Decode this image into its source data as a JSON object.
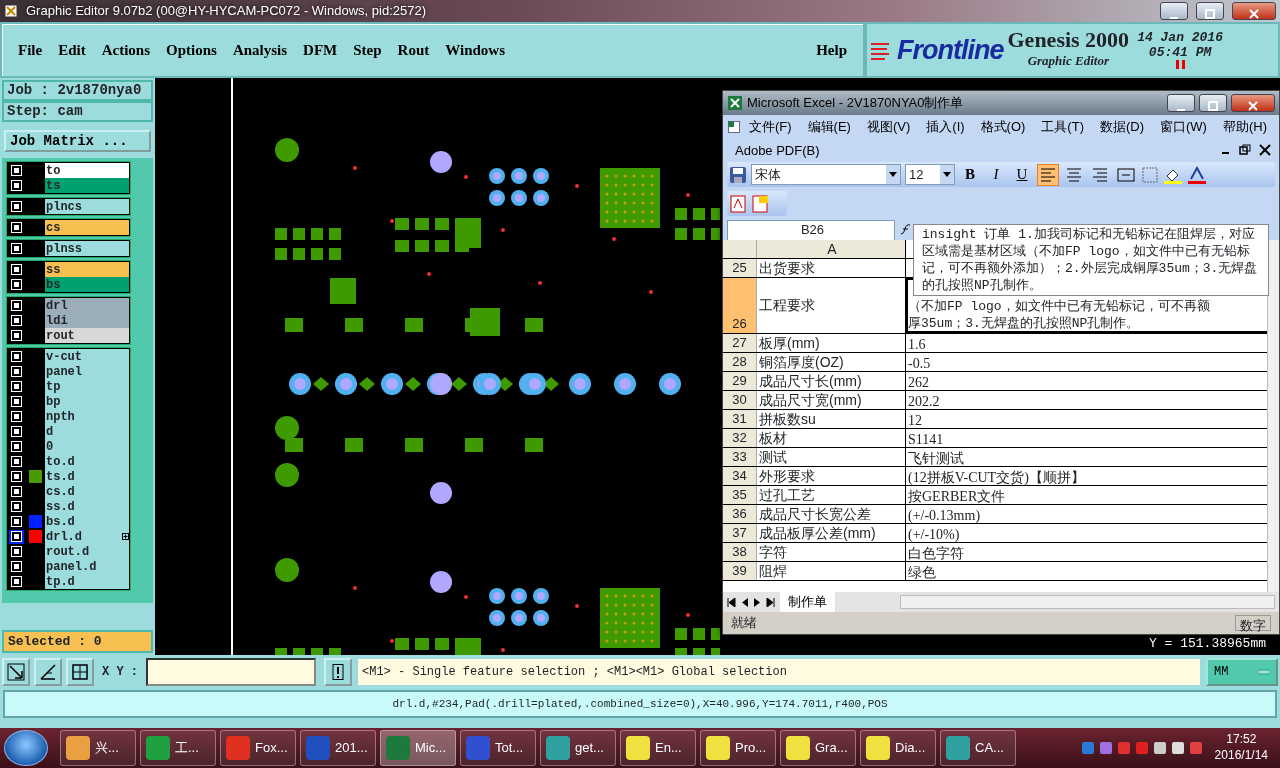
{
  "window": {
    "title": "Graphic Editor 9.07b2 (00@HY-HYCAM-PC072 - Windows, pid:2572)"
  },
  "menu": [
    "File",
    "Edit",
    "Actions",
    "Options",
    "Analysis",
    "DFM",
    "Step",
    "Rout",
    "Windows"
  ],
  "help": "Help",
  "brand": {
    "logo": "Frontline",
    "product": "Genesis 2000",
    "subtitle": "Graphic Editor",
    "date": "14 Jan 2016",
    "time": "05:41 PM"
  },
  "job": {
    "job": "Job : 2v1870nya0",
    "step": "Step: cam",
    "matrix_button": "Job Matrix ...",
    "selected": "Selected : 0"
  },
  "layer_groups": [
    [
      {
        "name": "to",
        "kind": "silk",
        "checked": false,
        "focused": false
      },
      {
        "name": "ts",
        "kind": "mask",
        "checked": false,
        "focused": false
      }
    ],
    [
      {
        "name": "plncs",
        "kind": "plane",
        "checked": false,
        "focused": false
      }
    ],
    [
      {
        "name": "cs",
        "kind": "signal",
        "checked": false,
        "focused": false
      }
    ],
    [
      {
        "name": "plnss",
        "kind": "plane",
        "checked": false,
        "focused": false
      }
    ],
    [
      {
        "name": "ss",
        "kind": "signal",
        "checked": false,
        "focused": false
      },
      {
        "name": "bs",
        "kind": "mask",
        "checked": false,
        "focused": false
      }
    ],
    [
      {
        "name": "drl",
        "kind": "drill",
        "checked": false,
        "focused": false
      },
      {
        "name": "ldi",
        "kind": "drill",
        "checked": false,
        "focused": false
      },
      {
        "name": "rout",
        "kind": "rout",
        "checked": false,
        "focused": false
      }
    ],
    [
      {
        "name": "v-cut",
        "kind": "document",
        "checked": false,
        "focused": false
      },
      {
        "name": "panel",
        "kind": "document",
        "checked": false,
        "focused": false
      },
      {
        "name": "tp",
        "kind": "document",
        "checked": false,
        "focused": false
      },
      {
        "name": "bp",
        "kind": "document",
        "checked": false,
        "focused": false
      },
      {
        "name": "npth",
        "kind": "document",
        "checked": false,
        "focused": false
      },
      {
        "name": "d",
        "kind": "document",
        "checked": false,
        "focused": false
      },
      {
        "name": "0",
        "kind": "document",
        "checked": false,
        "focused": false
      },
      {
        "name": "to.d",
        "kind": "document",
        "checked": false,
        "focused": false
      },
      {
        "name": "ts.d",
        "kind": "document",
        "color": "#4a9a00",
        "checked": false,
        "focused": false
      },
      {
        "name": "cs.d",
        "kind": "document",
        "checked": false,
        "focused": false
      },
      {
        "name": "ss.d",
        "kind": "document",
        "checked": false,
        "focused": false
      },
      {
        "name": "bs.d",
        "kind": "document",
        "color": "#0022ff",
        "checked": false,
        "focused": false
      },
      {
        "name": "drl.d",
        "kind": "document",
        "color": "#ff0000",
        "checked": false,
        "focused": true
      },
      {
        "name": "rout.d",
        "kind": "document",
        "checked": false,
        "focused": false
      },
      {
        "name": "panel.d",
        "kind": "document",
        "checked": false,
        "focused": false
      },
      {
        "name": "tp.d",
        "kind": "document",
        "checked": false,
        "focused": false
      }
    ]
  ],
  "coordinate_readout": "Y = 151.38965mm",
  "command_bar": {
    "xy_label": "X Y :",
    "message": "<M1> - Single feature selection ; <M1><M1> Global selection",
    "units": "MM"
  },
  "status_line": "drl.d,#234,Pad(.drill=plated,.combined_size=0),X=40.996,Y=174.7011,r400,POS",
  "excel": {
    "title": "Microsoft Excel - 2V1870NYA0制作单",
    "menu": [
      "文件(F)",
      "编辑(E)",
      "视图(V)",
      "插入(I)",
      "格式(O)",
      "工具(T)",
      "数据(D)",
      "窗口(W)",
      "帮助(H)"
    ],
    "menu_row2": "Adobe PDF(B)",
    "font": "宋体",
    "font_size": "12",
    "style_buttons": [
      "B",
      "I",
      "U"
    ],
    "align_buttons": [
      {
        "kind": "left",
        "selected": true
      },
      {
        "kind": "center",
        "selected": false
      },
      {
        "kind": "right",
        "selected": false
      },
      {
        "kind": "merge",
        "selected": false
      }
    ],
    "name_box": "B26",
    "formula": "insight 订单  1.加我司标记和无铅标记在阻焊层，对应区域需是基材区域（不加FP logo，如文件中已有无铅标记，可不再额外添加）；2.外层完成铜厚35um；3.无焊盘的孔按照NP孔制作。",
    "column_header": "A",
    "rows": [
      {
        "number": "25",
        "a": "出货要求",
        "selected": false
      },
      {
        "number": "26",
        "a": "工程要求",
        "b_lines": [
          "（不加FP logo，如文件中已有无铅标记，可不再额",
          "厚35um；3.无焊盘的孔按照NP孔制作。"
        ],
        "selected": true
      },
      {
        "number": "27",
        "a": "板厚(mm)",
        "b": "1.6",
        "selected": false
      },
      {
        "number": "28",
        "a": "铜箔厚度(OZ)",
        "b": "-0.5",
        "selected": false
      },
      {
        "number": "29",
        "a": "成品尺寸长(mm)",
        "b": "262",
        "selected": false
      },
      {
        "number": "30",
        "a": "成品尺寸宽(mm)",
        "b": "202.2",
        "selected": false
      },
      {
        "number": "31",
        "a": "拼板数su",
        "b": "12",
        "selected": false
      },
      {
        "number": "32",
        "a": "板材",
        "b": "S1141",
        "selected": false
      },
      {
        "number": "33",
        "a": "测试",
        "b": "飞针测试",
        "selected": false
      },
      {
        "number": "34",
        "a": "外形要求",
        "b": "(12拼板V-CUT交货)【顺拼】",
        "selected": false
      },
      {
        "number": "35",
        "a": "过孔工艺",
        "b": "按GERBER文件",
        "selected": false
      },
      {
        "number": "36",
        "a": "成品尺寸长宽公差",
        "b": "(+/-0.13mm)",
        "selected": false
      },
      {
        "number": "37",
        "a": "成品板厚公差(mm)",
        "b": "(+/-10%)",
        "selected": false
      },
      {
        "number": "38",
        "a": "字符",
        "b": "白色字符",
        "selected": false
      },
      {
        "number": "39",
        "a": "阻焊",
        "b": "绿色",
        "selected": false
      }
    ],
    "sheet_tab": "制作单",
    "status": "就绪",
    "status_mode": "数字"
  },
  "taskbar": {
    "items": [
      {
        "label": "兴...",
        "color": "#e8a040",
        "selected": false
      },
      {
        "label": "工...",
        "color": "#20a040",
        "selected": false
      },
      {
        "label": "Fox...",
        "color": "#e03020",
        "selected": false
      },
      {
        "label": "201...",
        "color": "#2050c0",
        "selected": false
      },
      {
        "label": "Mic...",
        "color": "#1e7a3c",
        "selected": true
      },
      {
        "label": "Tot...",
        "color": "#3050d0",
        "selected": false
      },
      {
        "label": "get...",
        "color": "#30a0a0",
        "selected": false
      },
      {
        "label": "En...",
        "color": "#f0e040",
        "selected": false
      },
      {
        "label": "Pro...",
        "color": "#f0e040",
        "selected": false
      },
      {
        "label": "Gra...",
        "color": "#f0e040",
        "selected": false
      },
      {
        "label": "Dia...",
        "color": "#f0e040",
        "selected": false
      },
      {
        "label": "CA...",
        "color": "#30a0a0",
        "selected": false
      }
    ],
    "time": "17:52",
    "date": "2016/1/14"
  }
}
